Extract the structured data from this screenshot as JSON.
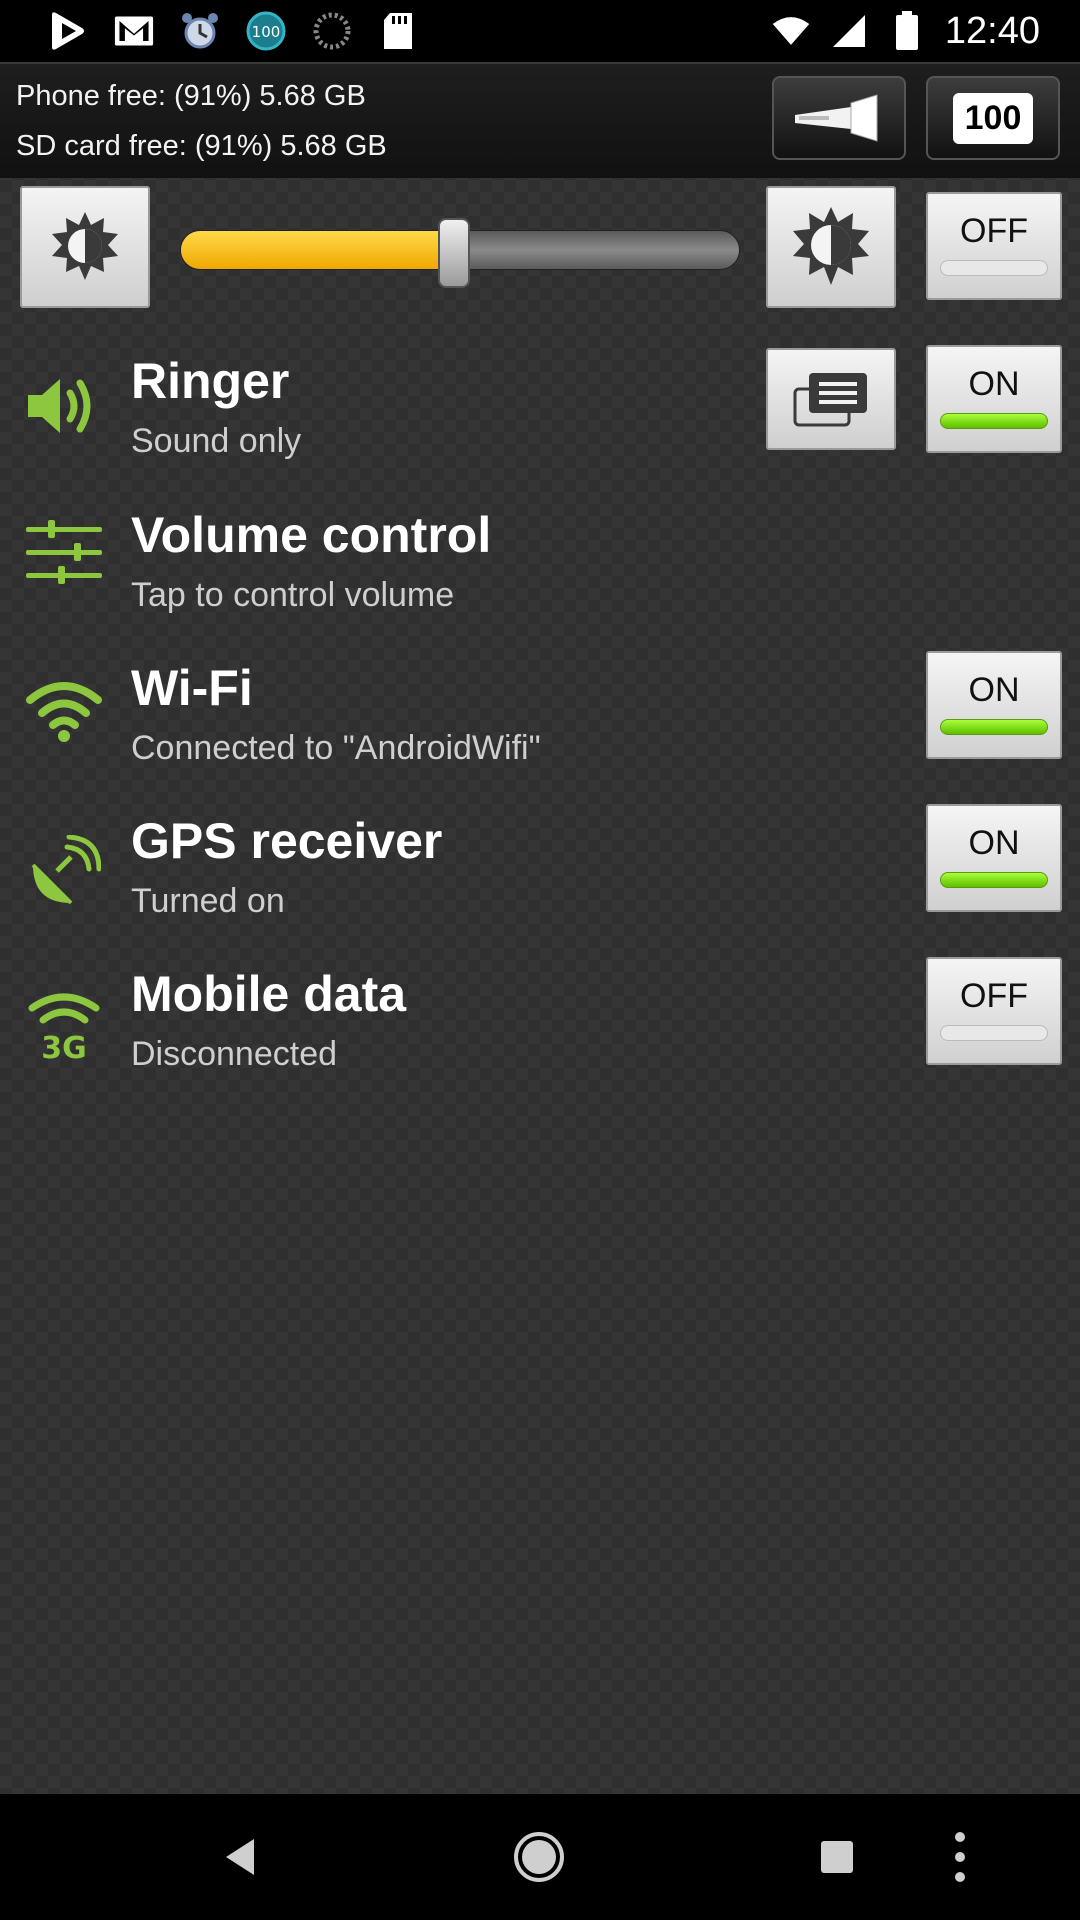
{
  "status_bar": {
    "time": "12:40",
    "notification_icons": [
      "play-store-icon",
      "gmail-icon",
      "alarm-icon",
      "battery-widget-icon",
      "loading-icon",
      "sd-card-icon"
    ],
    "battery_badge": "100"
  },
  "storage": {
    "phone_free": "Phone free: (91%) 5.68 GB",
    "sd_free": "SD card free: (91%) 5.68 GB",
    "battery_level": "100"
  },
  "brightness": {
    "level": 0.49,
    "auto_toggle": "OFF",
    "auto_state": "off"
  },
  "rows": [
    {
      "id": "ringer",
      "title": "Ringer",
      "subtitle": "Sound only",
      "toggle": "ON",
      "state": "on"
    },
    {
      "id": "volume",
      "title": "Volume control",
      "subtitle": "Tap to control volume"
    },
    {
      "id": "wifi",
      "title": "Wi-Fi",
      "subtitle": "Connected to \"AndroidWifi\"",
      "toggle": "ON",
      "state": "on"
    },
    {
      "id": "gps",
      "title": "GPS receiver",
      "subtitle": "Turned on",
      "toggle": "ON",
      "state": "on"
    },
    {
      "id": "mobile",
      "title": "Mobile data",
      "subtitle": "Disconnected",
      "toggle": "OFF",
      "state": "off"
    }
  ],
  "colors": {
    "accent_green": "#8dc63f",
    "slider_fill": "#f5b800",
    "toggle_on": "#7bdc10"
  }
}
